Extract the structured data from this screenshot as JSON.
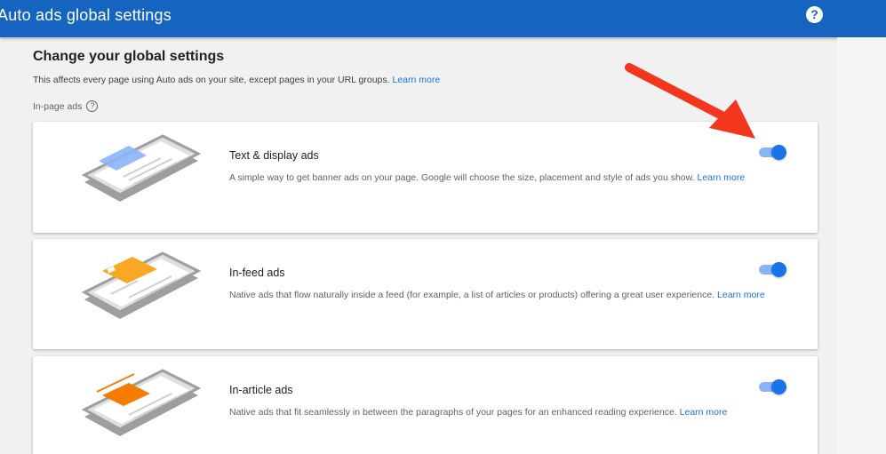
{
  "header": {
    "title": "Auto ads global settings",
    "help_icon": "?"
  },
  "main": {
    "heading": "Change your global settings",
    "subtext": "This affects every page using Auto ads on your site, except pages in your URL groups.",
    "subtext_link": "Learn more",
    "section_label": "In-page ads",
    "section_help_icon": "?"
  },
  "cards": [
    {
      "title": "Text & display ads",
      "description": "A simple way to get banner ads on your page. Google will choose the size, placement and style of ads you show.",
      "link": "Learn more",
      "enabled": true,
      "illustration_color": "#8ab4f8"
    },
    {
      "title": "In-feed ads",
      "description": "Native ads that flow naturally inside a feed (for example, a list of articles or products) offering a great user experience.",
      "link": "Learn more",
      "enabled": true,
      "illustration_color": "#f9a825"
    },
    {
      "title": "In-article ads",
      "description": "Native ads that fit seamlessly in between the paragraphs of your pages for an enhanced reading experience.",
      "link": "Learn more",
      "enabled": true,
      "illustration_color": "#f57c00"
    }
  ],
  "colors": {
    "header_bg": "#1565c0",
    "toggle_on": "#1a73e8",
    "link": "#1a73e8",
    "annotation_arrow": "#f4361e"
  }
}
